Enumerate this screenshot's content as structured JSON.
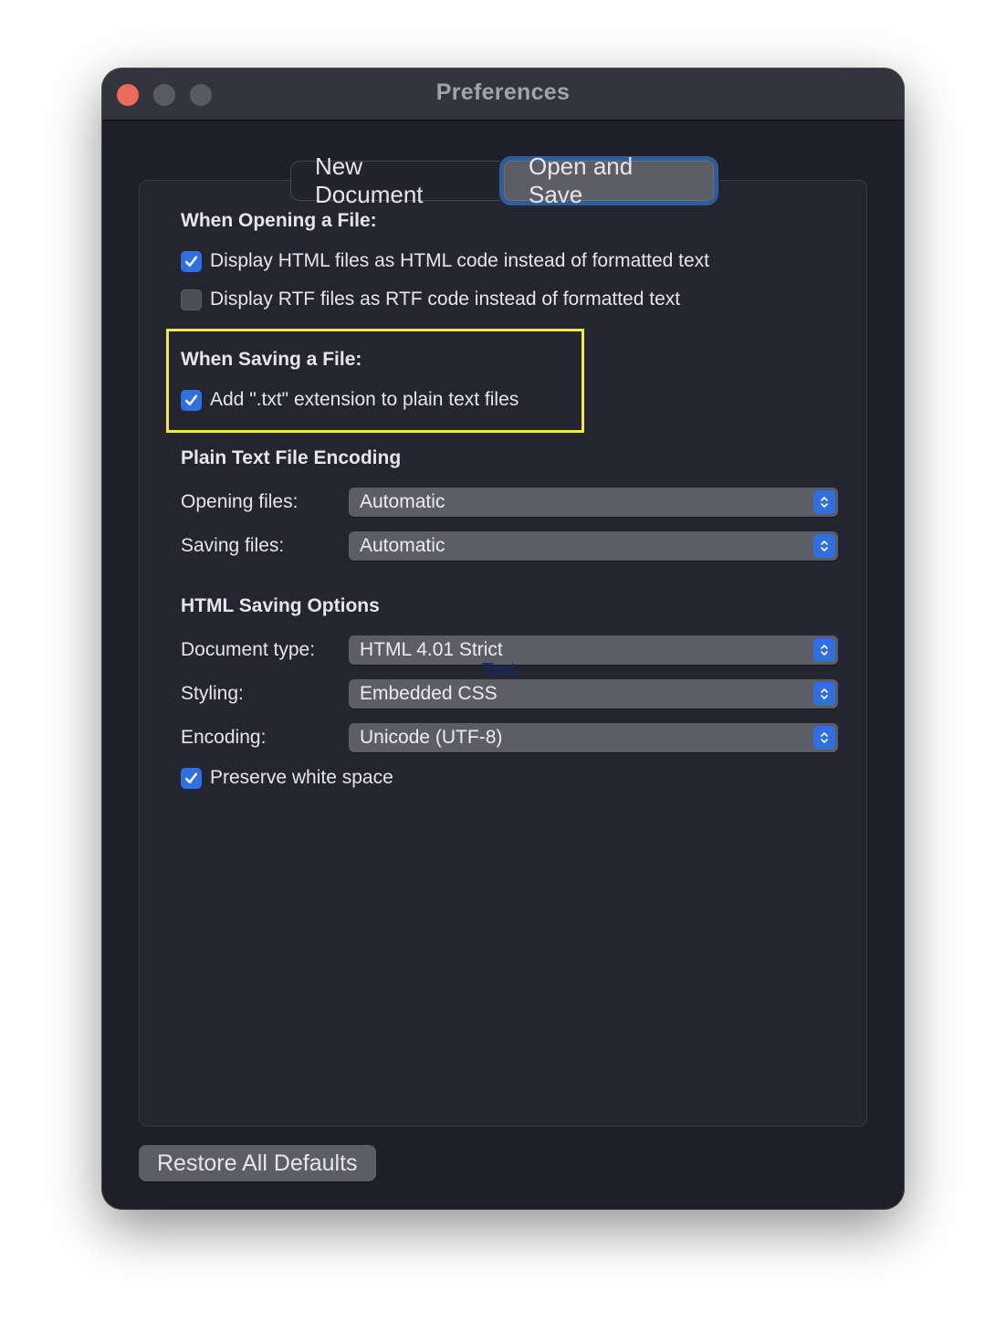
{
  "window": {
    "title": "Preferences",
    "traffic_lights": [
      "close",
      "minimize",
      "zoom"
    ]
  },
  "tabs": [
    {
      "label": "New Document",
      "active": false
    },
    {
      "label": "Open and Save",
      "active": true
    }
  ],
  "opening": {
    "title": "When Opening a File:",
    "options": [
      {
        "label": "Display HTML files as HTML code instead of formatted text",
        "checked": true
      },
      {
        "label": "Display RTF files as RTF code instead of formatted text",
        "checked": false
      }
    ]
  },
  "saving": {
    "title": "When Saving a File:",
    "options": [
      {
        "label": "Add \".txt\" extension to plain text files",
        "checked": true
      }
    ]
  },
  "encoding": {
    "title": "Plain Text File Encoding",
    "fields": [
      {
        "label": "Opening files:",
        "value": "Automatic"
      },
      {
        "label": "Saving files:",
        "value": "Automatic"
      }
    ]
  },
  "html_options": {
    "title": "HTML Saving Options",
    "fields": [
      {
        "label": "Document type:",
        "value": "HTML 4.01 Strict"
      },
      {
        "label": "Styling:",
        "value": "Embedded CSS"
      },
      {
        "label": "Encoding:",
        "value": "Unicode (UTF-8)"
      }
    ],
    "options": [
      {
        "label": "Preserve white space",
        "checked": true
      }
    ]
  },
  "overlay_text": "Text",
  "footer": {
    "restore_label": "Restore All Defaults"
  },
  "colors": {
    "accent": "#2f6fe0",
    "focus_ring": "#2e5e98",
    "highlight_box": "#f3e84a",
    "close_button": "#ed6a5e"
  }
}
